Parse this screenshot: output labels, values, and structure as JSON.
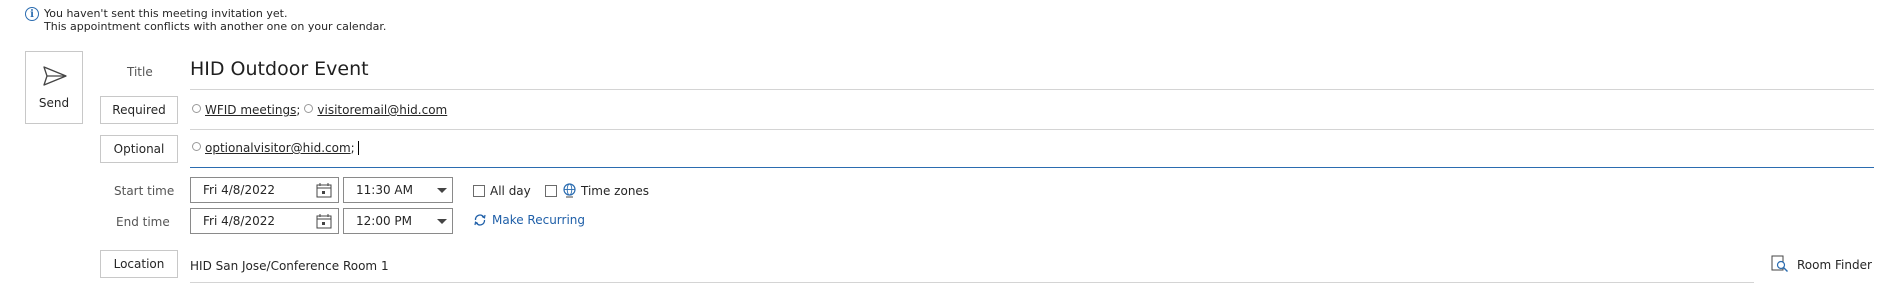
{
  "info": {
    "line1": "You haven't sent this meeting invitation yet.",
    "line2": "This appointment conflicts with another one on your calendar."
  },
  "send": {
    "label": "Send",
    "icon": "send-icon"
  },
  "title": {
    "label": "Title",
    "value": "HID Outdoor Event"
  },
  "required": {
    "label": "Required",
    "recipients": [
      "WFID meetings",
      "visitoremail@hid.com"
    ]
  },
  "optional": {
    "label": "Optional",
    "recipients": [
      "optionalvisitor@hid.com"
    ]
  },
  "start": {
    "label": "Start time",
    "date": "Fri 4/8/2022",
    "time": "11:30 AM"
  },
  "end": {
    "label": "End time",
    "date": "Fri 4/8/2022",
    "time": "12:00 PM"
  },
  "all_day": {
    "label": "All day",
    "checked": false
  },
  "time_zones": {
    "label": "Time zones",
    "icon": "globe-icon"
  },
  "make_recurring": {
    "label": "Make Recurring",
    "icon": "recurring-icon"
  },
  "location": {
    "label": "Location",
    "value": "HID San Jose/Conference Room 1"
  },
  "room_finder": {
    "label": "Room Finder",
    "icon": "room-finder-icon"
  },
  "colors": {
    "accent": "#2b6cb0",
    "link": "#1f5fa8",
    "border": "#c8c8c8"
  }
}
